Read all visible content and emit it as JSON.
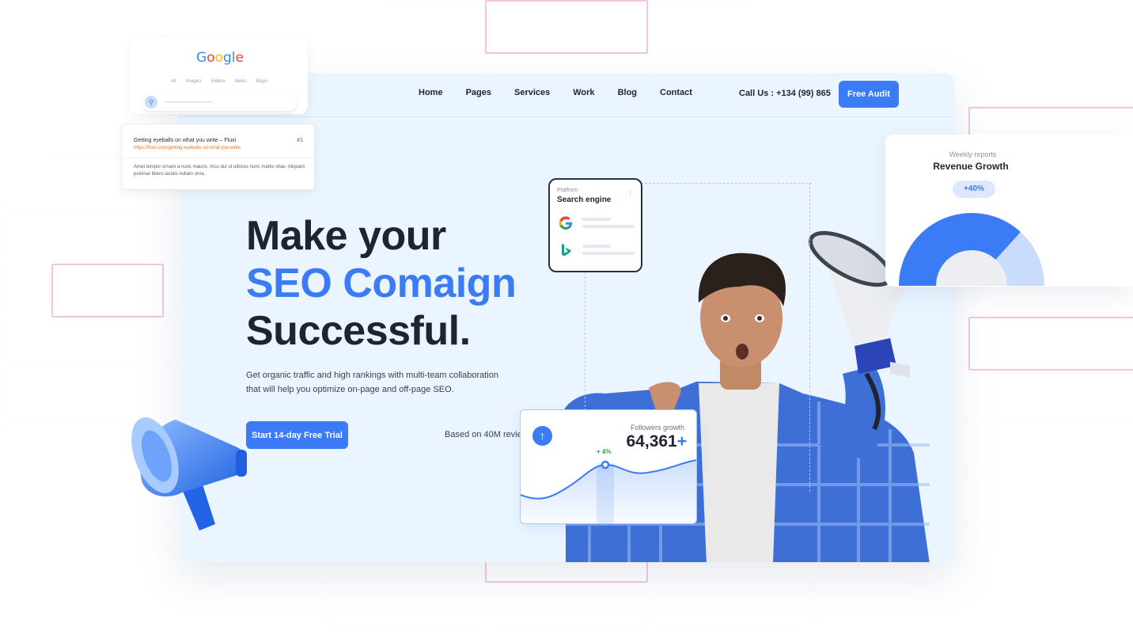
{
  "nav": {
    "links": [
      "Home",
      "Pages",
      "Services",
      "Work",
      "Blog",
      "Contact"
    ],
    "call_us": "Call Us : +134 (99) 865",
    "cta_label": "Free Audit"
  },
  "hero": {
    "line1": "Make your",
    "line2": "SEO Comaign",
    "line3": "Successful.",
    "description_line1": "Get organic traffic and high rankings with multi-team collaboration",
    "description_line2": "that will help you optimize on-page and off-page SEO.",
    "cta_label": "Start 14-day Free Trial",
    "reviews_text": "Based on 40M revie"
  },
  "platform_card": {
    "label": "Platfrom",
    "title": "Search engine",
    "icons": [
      "google-icon",
      "bing-icon"
    ]
  },
  "followers_card": {
    "label": "Followers growth",
    "value": "64,361",
    "value_suffix": "+",
    "change": "+ 4%",
    "icon": "arrow-up-icon"
  },
  "google_card": {
    "logo_letters": [
      "G",
      "o",
      "o",
      "g",
      "l",
      "e"
    ],
    "logo_colors": [
      "#4285F4",
      "#EA4335",
      "#FBBC05",
      "#4285F4",
      "#34A853",
      "#EA4335"
    ],
    "tabs": [
      "All",
      "Images",
      "Videos",
      "News",
      "Maps"
    ]
  },
  "search_result": {
    "title": "Getting eyeballs on what you write – Fluxi",
    "rank": "#1",
    "url": "https://fluxi.com/getting-eyeballs-on-what-you-write",
    "description": "Amet tempor ornare a nunc mauris. Arcu dui ut ultrices nunc mattis vitae. Aliquam pulvinar libero iaculis nullam urna."
  },
  "revenue_card": {
    "label": "Weekly reports",
    "title": "Revenue Growth",
    "badge": "+40%"
  },
  "colors": {
    "accent": "#3b7bf6",
    "card_bg": "#eaf5ff",
    "positive": "#2a9d5c"
  }
}
